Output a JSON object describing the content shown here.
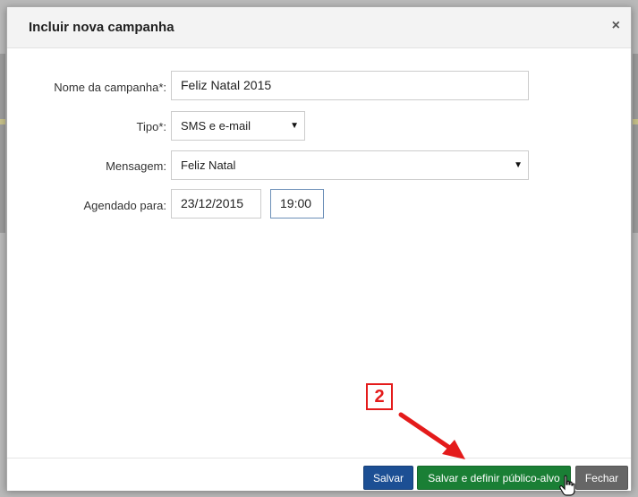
{
  "dialog": {
    "title": "Incluir nova campanha",
    "close_glyph": "×"
  },
  "form": {
    "nome_label": "Nome da campanha*:",
    "nome_value": "Feliz Natal 2015",
    "tipo_label": "Tipo*:",
    "tipo_value": "SMS e e-mail",
    "mensagem_label": "Mensagem:",
    "mensagem_value": "Feliz Natal",
    "agendado_label": "Agendado para:",
    "data_value": "23/12/2015",
    "hora_value": "19:00"
  },
  "footer": {
    "salvar_label": "Salvar",
    "salvar_definir_label": "Salvar e definir público-alvo",
    "fechar_label": "Fechar"
  },
  "annotation": {
    "step_number": "2"
  },
  "icons": {
    "close": "close-icon",
    "dropdown": "chevron-down-icon",
    "cursor": "hand-pointer-icon",
    "arrow": "red-arrow-annotation"
  },
  "colors": {
    "primary": "#1c4f94",
    "success": "#1a7f35",
    "default": "#666666",
    "annotation": "#e41b1b"
  }
}
